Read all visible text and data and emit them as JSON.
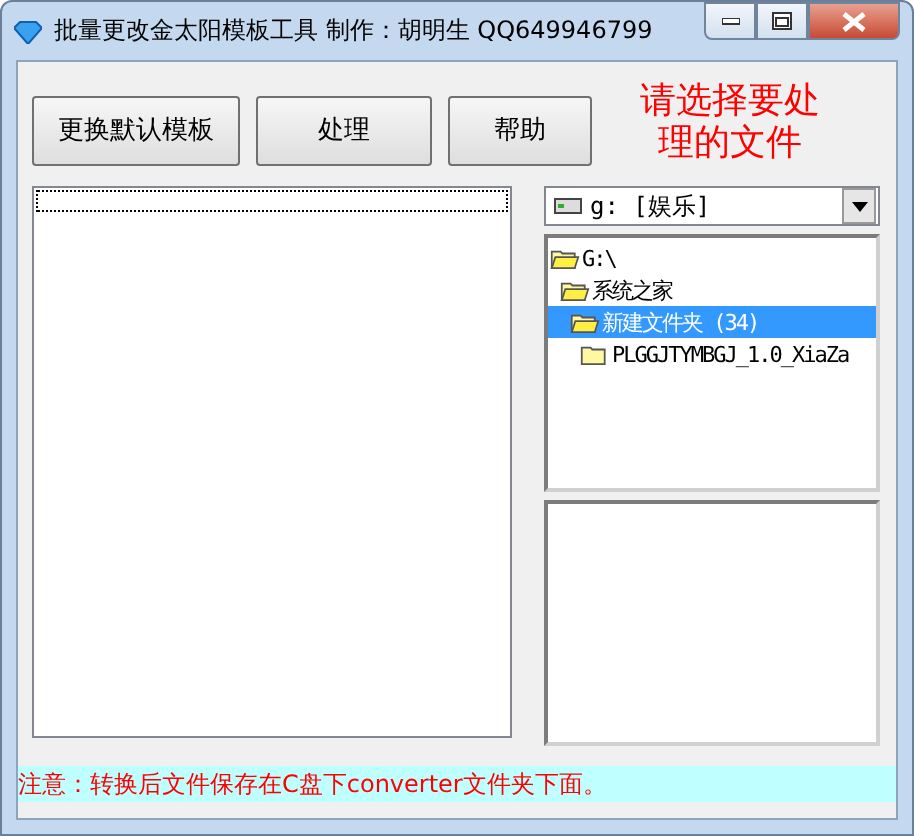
{
  "window": {
    "title": "批量更改金太阳模板工具 制作：胡明生 QQ649946799"
  },
  "buttons": [
    {
      "label": "更换默认模板"
    },
    {
      "label": "处理"
    },
    {
      "label": "帮助"
    }
  ],
  "hint": "请选择要处理的文件",
  "drive_select": {
    "value": "g: [娱乐]"
  },
  "folder_tree": [
    {
      "label": "G:\\",
      "expanded": true,
      "selected": false,
      "children": [
        {
          "label": "系统之家",
          "expanded": true,
          "selected": false,
          "children": [
            {
              "label": "新建文件夹 (34)",
              "expanded": true,
              "selected": true,
              "children": [
                {
                  "label": "PLGGJTYMBGJ_1.0_XiaZa",
                  "expanded": false,
                  "selected": false
                }
              ]
            }
          ]
        }
      ]
    }
  ],
  "status_bar": "注意：转换后文件保存在C盘下converter文件夹下面。"
}
